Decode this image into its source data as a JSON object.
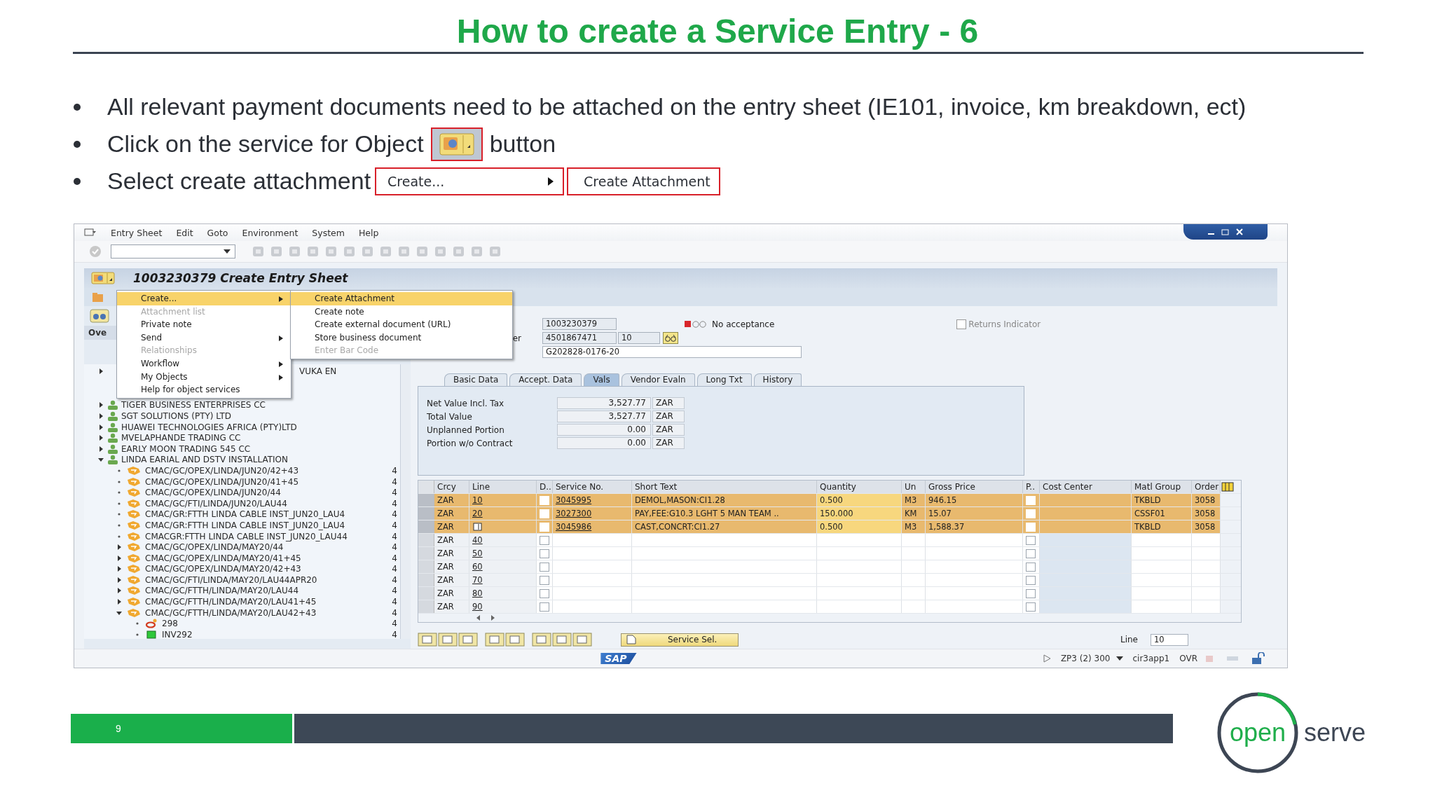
{
  "title": "How to create a Service Entry - 6",
  "bullets": [
    {
      "kind": "text",
      "text": "All relevant payment documents need to be attached on the entry sheet (IE101, invoice, km breakdown, ect)"
    },
    {
      "kind": "object_button",
      "text": "Click on the service for Object",
      "after": "button"
    },
    {
      "kind": "menu_path",
      "text": "Select create attachment",
      "menu_item": "Create...",
      "submenu_item": "Create Attachment"
    }
  ],
  "sap": {
    "menu_bar": [
      "Entry Sheet",
      "Edit",
      "Goto",
      "Environment",
      "System",
      "Help"
    ],
    "document_title": "1003230379 Create Entry Sheet",
    "object_menu": [
      {
        "label": "Create...",
        "disabled": false,
        "submenu": true,
        "selected": true
      },
      {
        "label": "Attachment list",
        "disabled": true,
        "submenu": false,
        "selected": false
      },
      {
        "label": "Private note",
        "disabled": false,
        "submenu": false,
        "selected": false
      },
      {
        "label": "Send",
        "disabled": false,
        "submenu": true,
        "selected": false
      },
      {
        "label": "Relationships",
        "disabled": true,
        "submenu": false,
        "selected": false
      },
      {
        "label": "Workflow",
        "disabled": false,
        "submenu": true,
        "selected": false
      },
      {
        "label": "My Objects",
        "disabled": false,
        "submenu": true,
        "selected": false
      },
      {
        "label": "Help for object services",
        "disabled": false,
        "submenu": false,
        "selected": false
      }
    ],
    "object_submenu": [
      {
        "label": "Create Attachment",
        "disabled": false,
        "selected": true
      },
      {
        "label": "Create note",
        "disabled": false,
        "selected": false
      },
      {
        "label": "Create external document (URL)",
        "disabled": false,
        "selected": false
      },
      {
        "label": "Store business document",
        "disabled": false,
        "selected": false
      },
      {
        "label": "Enter Bar Code",
        "disabled": true,
        "selected": false
      }
    ],
    "overview_tab": "Ove",
    "tree": [
      {
        "label": "VUKA EN",
        "kind": "partly_hidden",
        "expandable": true,
        "expanded": false
      },
      {
        "label": "TIGER BUSINESS ENTERPRISES CC",
        "kind": "vendor",
        "expandable": true,
        "expanded": false
      },
      {
        "label": "SGT SOLUTIONS (PTY) LTD",
        "kind": "vendor",
        "expandable": true,
        "expanded": false
      },
      {
        "label": "HUAWEI TECHNOLOGIES AFRICA (PTY)LTD",
        "kind": "vendor",
        "expandable": true,
        "expanded": false
      },
      {
        "label": "MVELAPHANDE TRADING CC",
        "kind": "vendor",
        "expandable": true,
        "expanded": false
      },
      {
        "label": "EARLY MOON TRADING 545 CC",
        "kind": "vendor",
        "expandable": true,
        "expanded": false
      },
      {
        "label": "LINDA EARIAL AND DSTV INSTALLATION",
        "kind": "vendor",
        "expandable": true,
        "expanded": true,
        "children": [
          {
            "label": "CMAC/GC/OPEX/LINDA/JUN20/42+43",
            "kind": "order",
            "count": "4",
            "expandable": false,
            "expanded": false
          },
          {
            "label": "CMAC/GC/OPEX/LINDA/JUN20/41+45",
            "kind": "order",
            "count": "4",
            "expandable": false,
            "expanded": false
          },
          {
            "label": "CMAC/GC/OPEX/LINDA/JUN20/44",
            "kind": "order",
            "count": "4",
            "expandable": false,
            "expanded": false
          },
          {
            "label": "CMAC/GC/FTI/LINDA/JUN20/LAU44",
            "kind": "order",
            "count": "4",
            "expandable": false,
            "expanded": false
          },
          {
            "label": "CMAC/GR:FTTH LINDA CABLE INST_JUN20_LAU4",
            "kind": "order",
            "count": "4",
            "expandable": false,
            "expanded": false
          },
          {
            "label": "CMAC/GR:FTTH LINDA CABLE INST_JUN20_LAU4",
            "kind": "order",
            "count": "4",
            "expandable": false,
            "expanded": false
          },
          {
            "label": "CMACGR:FTTH LINDA CABLE INST_JUN20_LAU44",
            "kind": "order",
            "count": "4",
            "expandable": false,
            "expanded": false
          },
          {
            "label": "CMAC/GC/OPEX/LINDA/MAY20/44",
            "kind": "order",
            "count": "4",
            "expandable": true,
            "expanded": false
          },
          {
            "label": "CMAC/GC/OPEX/LINDA/MAY20/41+45",
            "kind": "order",
            "count": "4",
            "expandable": true,
            "expanded": false
          },
          {
            "label": "CMAC/GC/OPEX/LINDA/MAY20/42+43",
            "kind": "order",
            "count": "4",
            "expandable": true,
            "expanded": false
          },
          {
            "label": "CMAC/GC/FTI/LINDA/MAY20/LAU44APR20",
            "kind": "order",
            "count": "4",
            "expandable": true,
            "expanded": false
          },
          {
            "label": "CMAC/GC/FTTH/LINDA/MAY20/LAU44",
            "kind": "order",
            "count": "4",
            "expandable": true,
            "expanded": false
          },
          {
            "label": "CMAC/GC/FTTH/LINDA/MAY20/LAU41+45",
            "kind": "order",
            "count": "4",
            "expandable": true,
            "expanded": false
          },
          {
            "label": "CMAC/GC/FTTH/LINDA/MAY20/LAU42+43",
            "kind": "order",
            "count": "4",
            "expandable": true,
            "expanded": true,
            "children": [
              {
                "label": "298",
                "kind": "entry_sheet",
                "count": "4",
                "expandable": false,
                "expanded": false
              },
              {
                "label": "INV292",
                "kind": "invoice",
                "count": "4",
                "expandable": false,
                "expanded": false
              }
            ]
          }
        ]
      }
    ],
    "header": {
      "entry_sheet": "1003230379",
      "acceptance": "No acceptance",
      "returns_indicator": {
        "label": "Returns Indicator",
        "checked": false
      },
      "po_label": "er",
      "po_number": "4501867471",
      "po_item": "10",
      "short_text": "G202828-0176-20"
    },
    "tabs": [
      {
        "label": "Basic Data",
        "selected": false
      },
      {
        "label": "Accept. Data",
        "selected": false
      },
      {
        "label": "Vals",
        "selected": true
      },
      {
        "label": "Vendor Evaln",
        "selected": false
      },
      {
        "label": "Long Txt",
        "selected": false
      },
      {
        "label": "History",
        "selected": false
      }
    ],
    "values": [
      {
        "label": "Net Value Incl. Tax",
        "amount": "3,527.77",
        "currency": "ZAR"
      },
      {
        "label": "Total Value",
        "amount": "3,527.77",
        "currency": "ZAR"
      },
      {
        "label": "Unplanned Portion",
        "amount": "0.00",
        "currency": "ZAR"
      },
      {
        "label": "Portion w/o Contract",
        "amount": "0.00",
        "currency": "ZAR"
      }
    ],
    "table": {
      "columns": [
        "Crcy",
        "Line",
        "D..",
        "Service No.",
        "Short Text",
        "Quantity",
        "Un",
        "Gross Price",
        "P..",
        "Cost Center",
        "Matl Group",
        "Order"
      ],
      "rows": [
        {
          "selected": true,
          "editing": false,
          "d_checked": false,
          "p_checked": false,
          "currency": "ZAR",
          "line": "10",
          "service_no": "3045995",
          "short_text": "DEMOL,MASON:CI1.28",
          "quantity": "0.500",
          "unit": "M3",
          "gross_price": "946.15",
          "matl_group": "TKBLD",
          "order": "3058"
        },
        {
          "selected": true,
          "editing": false,
          "d_checked": false,
          "p_checked": false,
          "currency": "ZAR",
          "line": "20",
          "service_no": "3027300",
          "short_text": "PAY,FEE:G10.3 LGHT 5 MAN TEAM ..",
          "quantity": "150.000",
          "unit": "KM",
          "gross_price": "15.07",
          "matl_group": "CSSF01",
          "order": "3058"
        },
        {
          "selected": true,
          "editing": true,
          "d_checked": false,
          "p_checked": false,
          "currency": "ZAR",
          "service_no": "3045986",
          "short_text": "CAST,CONCRT:CI1.27",
          "quantity": "0.500",
          "unit": "M3",
          "gross_price": "1,588.37",
          "matl_group": "TKBLD",
          "order": "3058"
        },
        {
          "selected": false,
          "editing": false,
          "d_checked": false,
          "p_checked": false,
          "currency": "ZAR",
          "line": "40"
        },
        {
          "selected": false,
          "editing": false,
          "d_checked": false,
          "p_checked": false,
          "currency": "ZAR",
          "line": "50"
        },
        {
          "selected": false,
          "editing": false,
          "d_checked": false,
          "p_checked": false,
          "currency": "ZAR",
          "line": "60"
        },
        {
          "selected": false,
          "editing": false,
          "d_checked": false,
          "p_checked": false,
          "currency": "ZAR",
          "line": "70"
        },
        {
          "selected": false,
          "editing": false,
          "d_checked": false,
          "p_checked": false,
          "currency": "ZAR",
          "line": "80"
        },
        {
          "selected": false,
          "editing": false,
          "d_checked": false,
          "p_checked": false,
          "currency": "ZAR",
          "line": "90"
        }
      ]
    },
    "service_sel_button": "Service Sel.",
    "line_field": {
      "label": "Line",
      "value": "10"
    },
    "status_bar": {
      "logo": "SAP",
      "system": "ZP3 (2) 300",
      "server": "cir3app1",
      "mode": "OVR"
    }
  },
  "footer": {
    "page": "9"
  },
  "logo": {
    "first": "open",
    "second": "serve"
  }
}
